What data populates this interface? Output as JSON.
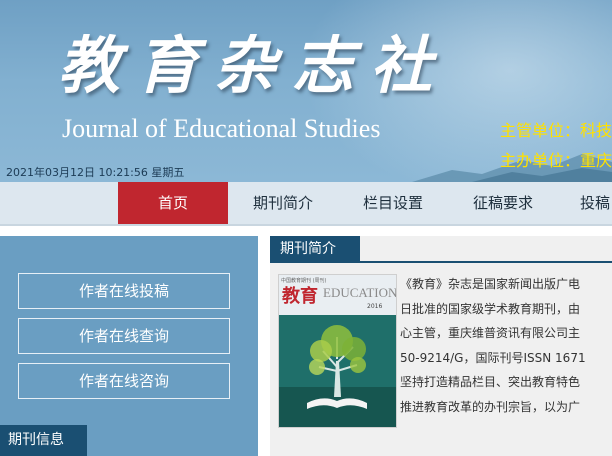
{
  "header": {
    "cn_title": "教育杂志社",
    "en_title": "Journal of Educational Studies",
    "supervisor": "主管单位：科技",
    "sponsor": "主办单位：重庆",
    "datetime": "2021年03月12日 10:21:56 星期五"
  },
  "nav": {
    "items": [
      {
        "label": "首页",
        "active": true
      },
      {
        "label": "期刊简介",
        "active": false
      },
      {
        "label": "栏目设置",
        "active": false
      },
      {
        "label": "征稿要求",
        "active": false
      },
      {
        "label": "投稿",
        "active": false
      }
    ]
  },
  "sidebar": {
    "buttons": [
      "作者在线投稿",
      "作者在线查询",
      "作者在线咨询"
    ],
    "section_title": "期刊信息"
  },
  "main": {
    "section_title": "期刊简介",
    "cover": {
      "masthead": "教育",
      "masthead_en": "EDUCATION",
      "year": "2016",
      "top_text": "中国教育期刊 (周刊)"
    },
    "intro_lines": [
      "《教育》杂志是国家新闻出版广电",
      "日批准的国家级学术教育期刊，由",
      "心主管，重庆维普资讯有限公司主",
      "50-9214/G，国际刊号ISSN 1671",
      "坚持打造精品栏目、突出教育特色",
      "推进教育改革的办刊宗旨，以为广"
    ]
  },
  "colors": {
    "header_blue": "#7aa9cb",
    "nav_active_red": "#c0262f",
    "section_dark_blue": "#1a4f72",
    "org_yellow": "#ffe100"
  }
}
